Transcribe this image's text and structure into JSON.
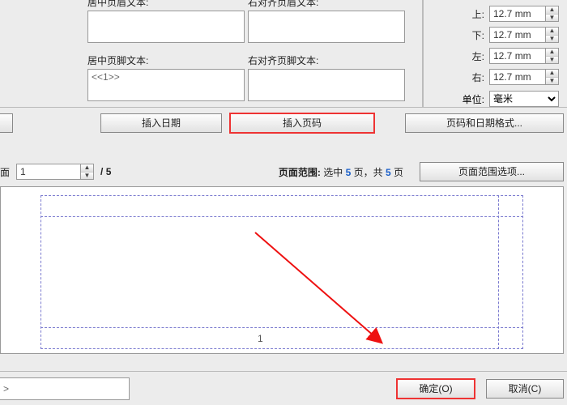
{
  "header_left_label": "居中页眉文本:",
  "header_right_label": "右对齐页眉文本:",
  "footer_left_label": "居中页脚文本:",
  "footer_right_label": "右对齐页脚文本:",
  "footer_left_value": "<<1>>",
  "margins": {
    "top": {
      "label": "上:",
      "value": "12.7 mm"
    },
    "bottom": {
      "label": "下:",
      "value": "12.7 mm"
    },
    "left": {
      "label": "左:",
      "value": "12.7 mm"
    },
    "right": {
      "label": "右:",
      "value": "12.7 mm"
    }
  },
  "unit_label": "单位:",
  "unit_value": "毫米",
  "buttons": {
    "insert_date": "插入日期",
    "insert_page_num": "插入页码",
    "format": "页码和日期格式...",
    "range_options": "页面范围选项...",
    "ok": "确定(O)",
    "cancel": "取消(C)"
  },
  "nav": {
    "page_label": "面",
    "current": "1",
    "total_prefix": "/ ",
    "total": "5"
  },
  "range": {
    "label": "页面范围:",
    "selected_prefix": "选中 ",
    "selected": "5",
    "selected_suffix": " 页，共 ",
    "total": "5",
    "total_suffix": " 页"
  },
  "preview_page_number": "1",
  "footer_inset_glyph": ">"
}
